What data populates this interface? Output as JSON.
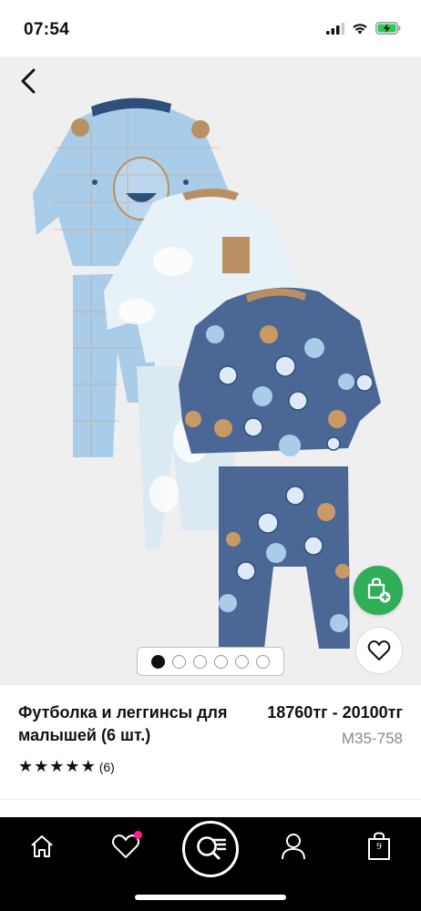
{
  "status_bar": {
    "time": "07:54",
    "icons": [
      "signal-icon",
      "wifi-icon",
      "battery-charging-icon"
    ]
  },
  "gallery": {
    "image_description_name": "product-photo",
    "page_count": 6,
    "active_page": 1
  },
  "product": {
    "title": "Футболка и леггинсы для малышей (6 шт.)",
    "price": "18760тг - 20100тг",
    "sku": "M35-758",
    "rating_stars": 5,
    "rating_count": "(6)"
  },
  "tabbar": {
    "items": [
      "home-icon",
      "heart-icon",
      "search-list-icon",
      "user-icon",
      "bag-icon"
    ],
    "bag_count": "9",
    "favorites_badge": true
  },
  "colors": {
    "accent_green": "#2fae57",
    "badge_pink": "#ff1f8e",
    "tabbar_bg": "#000000"
  }
}
